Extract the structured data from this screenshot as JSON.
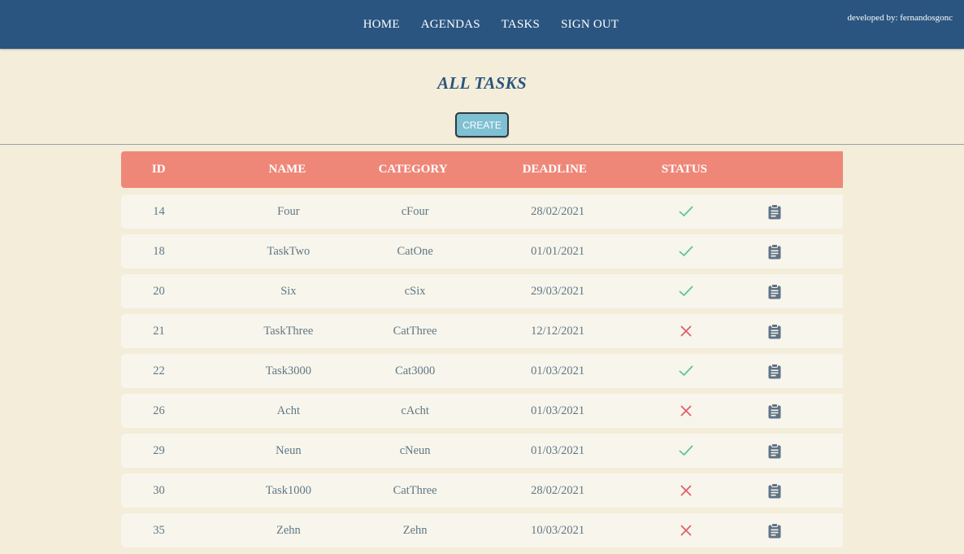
{
  "nav": {
    "items": [
      "HOME",
      "AGENDAS",
      "TASKS",
      "SIGN OUT"
    ],
    "developer": "developed by: fernandosgonc"
  },
  "page": {
    "title": "ALL TASKS",
    "create_label": "CREATE"
  },
  "table": {
    "headers": {
      "id": "ID",
      "name": "NAME",
      "category": "CATEGORY",
      "deadline": "DEADLINE",
      "status": "STATUS"
    },
    "rows": [
      {
        "id": "14",
        "name": "Four",
        "category": "cFour",
        "deadline": "28/02/2021",
        "done": true
      },
      {
        "id": "18",
        "name": "TaskTwo",
        "category": "CatOne",
        "deadline": "01/01/2021",
        "done": true
      },
      {
        "id": "20",
        "name": "Six",
        "category": "cSix",
        "deadline": "29/03/2021",
        "done": true
      },
      {
        "id": "21",
        "name": "TaskThree",
        "category": "CatThree",
        "deadline": "12/12/2021",
        "done": false
      },
      {
        "id": "22",
        "name": "Task3000",
        "category": "Cat3000",
        "deadline": "01/03/2021",
        "done": true
      },
      {
        "id": "26",
        "name": "Acht",
        "category": "cAcht",
        "deadline": "01/03/2021",
        "done": false
      },
      {
        "id": "29",
        "name": "Neun",
        "category": "cNeun",
        "deadline": "01/03/2021",
        "done": true
      },
      {
        "id": "30",
        "name": "Task1000",
        "category": "CatThree",
        "deadline": "28/02/2021",
        "done": false
      },
      {
        "id": "35",
        "name": "Zehn",
        "category": "Zehn",
        "deadline": "10/03/2021",
        "done": false
      }
    ]
  },
  "icons": {
    "done": "check-icon",
    "not_done": "cross-icon",
    "details": "clipboard-icon"
  },
  "colors": {
    "topbar": "#2a5580",
    "background": "#f3edd9",
    "header": "#ef8778",
    "check": "#5cc49a",
    "cross": "#e0606a",
    "clipboard": "#5f7386",
    "create": "#7fc0d3"
  }
}
